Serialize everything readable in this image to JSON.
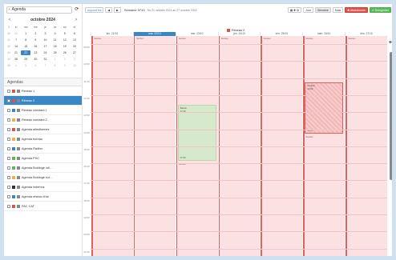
{
  "app": {
    "title": "Agenda",
    "back_icon": "back-icon",
    "refresh_icon": "refresh-icon"
  },
  "mini_calendar": {
    "title": "octobre 2024",
    "prev": "<",
    "next": ">",
    "headers": [
      "S",
      "lu",
      "ma",
      "me",
      "je",
      "ve",
      "sa",
      "di"
    ],
    "rows": [
      [
        "40",
        "30",
        "1",
        "2",
        "3",
        "4",
        "5",
        "6"
      ],
      [
        "41",
        "7",
        "8",
        "9",
        "10",
        "11",
        "12",
        "13"
      ],
      [
        "42",
        "14",
        "15",
        "16",
        "17",
        "18",
        "19",
        "20"
      ],
      [
        "43",
        "21",
        "22",
        "23",
        "24",
        "25",
        "26",
        "27"
      ],
      [
        "44",
        "28",
        "29",
        "30",
        "31",
        "1",
        "2",
        "3"
      ],
      [
        "45",
        "4",
        "5",
        "6",
        "7",
        "8",
        "9",
        "10"
      ]
    ],
    "selected": "22"
  },
  "agendas": {
    "header": "Agendas",
    "items": [
      {
        "label": "Réseau 1",
        "color": "#d9534f"
      },
      {
        "label": "Réseau 2",
        "color": "#d9534f",
        "active": true
      },
      {
        "label": "Réseau constant 1",
        "color": "#3a87c8"
      },
      {
        "label": "Réseau constant 2",
        "color": "#f0ad4e"
      },
      {
        "label": "Agenda allesthemes",
        "color": "#d9534f"
      },
      {
        "label": "Agenda bureau",
        "color": "#f0ad4e"
      },
      {
        "label": "Agenda Radfox",
        "color": "#3a87c8"
      },
      {
        "label": "Agenda PHC",
        "color": "#5cb85c"
      },
      {
        "label": "Agenda Boldinge intl…",
        "color": "#5cb85c"
      },
      {
        "label": "Agenda Boldinge ecf…",
        "color": "#f0ad4e"
      },
      {
        "label": "Agenda indemos",
        "color": "#333333"
      },
      {
        "label": "Agenda réseau d'air",
        "color": "#3a87c8"
      },
      {
        "label": "PAC CAT",
        "color": "#d9534f"
      }
    ]
  },
  "toolbar": {
    "today": "Aujourd'hui",
    "prev": "◀",
    "next": "▶",
    "week": "Semaine N°43",
    "range": "Du 21 octobre 2024 au 27 octobre 2024",
    "view_controls": "▦ ✚ ⚙",
    "views": [
      "Jour",
      "Semaine",
      "Mois"
    ],
    "abort": "✖ Abandonner",
    "save": "✔ Enregistrer"
  },
  "legend": {
    "label": "Réseau 2"
  },
  "days": [
    "lun. 21/10",
    "mar. 22/10",
    "mer. 23/10",
    "jeu. 24/10",
    "ven. 25/10",
    "sam. 26/10",
    "dim. 27/10"
  ],
  "hours": [
    "09:00",
    "10:00",
    "11:00",
    "12:00",
    "13:00",
    "14:00",
    "15:00",
    "16:00",
    "17:00",
    "18:00",
    "19:00",
    "20:00",
    "21:00"
  ],
  "column_label": "Sanitec",
  "events": {
    "green": {
      "title": "Bassin",
      "time": "07:30",
      "end": "07:00"
    },
    "hatch": {
      "title": "Contrôl",
      "time": "14:00",
      "end": "16:00"
    },
    "label_b": "Sanitec",
    "label_c": "Sanitec"
  },
  "colors": {
    "accent": "#3a87c8",
    "closed": "#fbe1e1",
    "line": "#e06060"
  }
}
